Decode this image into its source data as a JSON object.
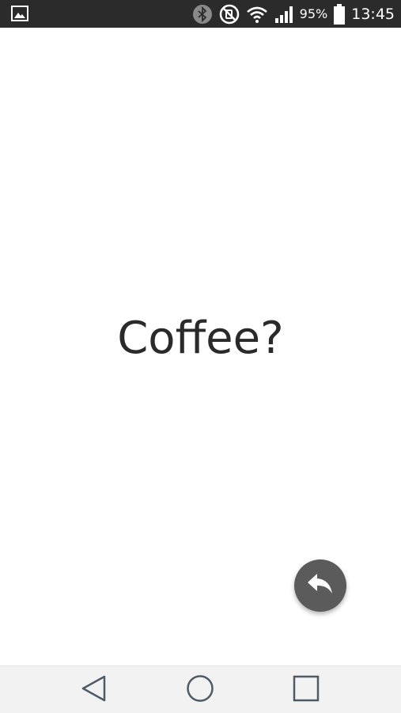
{
  "status_bar": {
    "notification_icon": "image-icon",
    "icons": [
      "bluetooth-icon",
      "mute-icon",
      "wifi-icon",
      "signal-icon"
    ],
    "battery_percent": "95%",
    "time": "13:45"
  },
  "main": {
    "prompt_text": "Coffee?",
    "fab_icon": "reply-icon"
  },
  "nav_bar": {
    "buttons": [
      "back-icon",
      "home-icon",
      "recent-apps-icon"
    ]
  },
  "colors": {
    "status_bar_bg": "#2b2b2b",
    "fab_bg": "#5b5b5b",
    "nav_bar_bg": "#f2f2f2",
    "text": "#2a2a2a"
  }
}
